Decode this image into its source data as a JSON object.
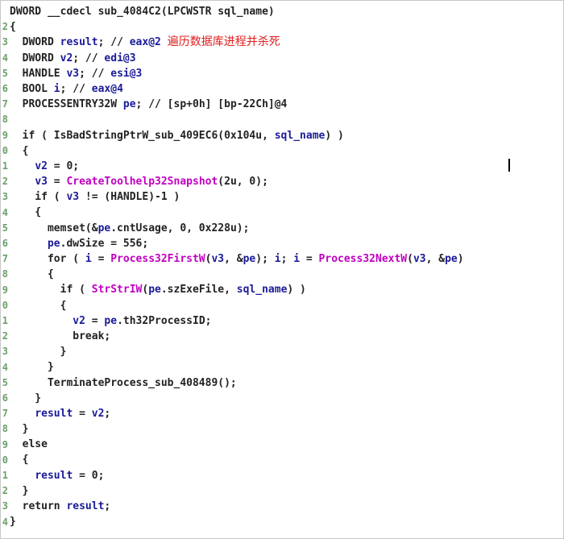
{
  "gutter": [
    "",
    "2",
    "3",
    "4",
    "5",
    "6",
    "7",
    "8",
    "9",
    "0",
    "1",
    "2",
    "3",
    "4",
    "5",
    "6",
    "7",
    "8",
    "9",
    "0",
    "1",
    "2",
    "3",
    "4",
    "5",
    "6",
    "7",
    "8",
    "9",
    "0",
    "1",
    "2",
    "3",
    "4"
  ],
  "lines": [
    [
      [
        "txt",
        "DWORD __cdecl sub_4084C2(LPCWSTR sql_name)"
      ]
    ],
    [
      [
        "txt",
        "{"
      ]
    ],
    [
      [
        "txt",
        "  DWORD "
      ],
      [
        "kw",
        "result"
      ],
      [
        "txt",
        "; // "
      ],
      [
        "kw",
        "eax@2"
      ],
      [
        "txt",
        " "
      ],
      [
        "cjk",
        "遍历数据库进程并杀死"
      ]
    ],
    [
      [
        "txt",
        "  DWORD "
      ],
      [
        "kw",
        "v2"
      ],
      [
        "txt",
        "; // "
      ],
      [
        "kw",
        "edi@3"
      ]
    ],
    [
      [
        "txt",
        "  HANDLE "
      ],
      [
        "kw",
        "v3"
      ],
      [
        "txt",
        "; // "
      ],
      [
        "kw",
        "esi@3"
      ]
    ],
    [
      [
        "txt",
        "  BOOL "
      ],
      [
        "kw",
        "i"
      ],
      [
        "txt",
        "; // "
      ],
      [
        "kw",
        "eax@4"
      ]
    ],
    [
      [
        "txt",
        "  PROCESSENTRY32W "
      ],
      [
        "kw",
        "pe"
      ],
      [
        "txt",
        "; // [sp+0h] [bp-22Ch]@4"
      ]
    ],
    [
      [
        "txt",
        ""
      ]
    ],
    [
      [
        "txt",
        "  if ( IsBadStringPtrW_sub_409EC6(0x104u, "
      ],
      [
        "kw",
        "sql_name"
      ],
      [
        "txt",
        ") )"
      ]
    ],
    [
      [
        "txt",
        "  {"
      ]
    ],
    [
      [
        "txt",
        "    "
      ],
      [
        "kw",
        "v2"
      ],
      [
        "txt",
        " = 0;"
      ]
    ],
    [
      [
        "txt",
        "    "
      ],
      [
        "kw",
        "v3"
      ],
      [
        "txt",
        " = "
      ],
      [
        "fn",
        "CreateToolhelp32Snapshot"
      ],
      [
        "txt",
        "(2u, 0);"
      ]
    ],
    [
      [
        "txt",
        "    if ( "
      ],
      [
        "kw",
        "v3"
      ],
      [
        "txt",
        " != (HANDLE)-1 )"
      ]
    ],
    [
      [
        "txt",
        "    {"
      ]
    ],
    [
      [
        "txt",
        "      memset(&"
      ],
      [
        "kw",
        "pe"
      ],
      [
        "txt",
        ".cntUsage, 0, 0x228u);"
      ]
    ],
    [
      [
        "txt",
        "      "
      ],
      [
        "kw",
        "pe"
      ],
      [
        "txt",
        ".dwSize = 556;"
      ]
    ],
    [
      [
        "txt",
        "      for ( "
      ],
      [
        "kw",
        "i"
      ],
      [
        "txt",
        " = "
      ],
      [
        "fn",
        "Process32FirstW"
      ],
      [
        "txt",
        "("
      ],
      [
        "kw",
        "v3"
      ],
      [
        "txt",
        ", &"
      ],
      [
        "kw",
        "pe"
      ],
      [
        "txt",
        "); "
      ],
      [
        "kw",
        "i"
      ],
      [
        "txt",
        "; "
      ],
      [
        "kw",
        "i"
      ],
      [
        "txt",
        " = "
      ],
      [
        "fn",
        "Process32NextW"
      ],
      [
        "txt",
        "("
      ],
      [
        "kw",
        "v3"
      ],
      [
        "txt",
        ", &"
      ],
      [
        "kw",
        "pe"
      ],
      [
        "txt",
        ")"
      ]
    ],
    [
      [
        "txt",
        "      {"
      ]
    ],
    [
      [
        "txt",
        "        if ( "
      ],
      [
        "fn",
        "StrStrIW"
      ],
      [
        "txt",
        "("
      ],
      [
        "kw",
        "pe"
      ],
      [
        "txt",
        ".szExeFile, "
      ],
      [
        "kw",
        "sql_name"
      ],
      [
        "txt",
        ") )"
      ]
    ],
    [
      [
        "txt",
        "        {"
      ]
    ],
    [
      [
        "txt",
        "          "
      ],
      [
        "kw",
        "v2"
      ],
      [
        "txt",
        " = "
      ],
      [
        "kw",
        "pe"
      ],
      [
        "txt",
        ".th32ProcessID;"
      ]
    ],
    [
      [
        "txt",
        "          break;"
      ]
    ],
    [
      [
        "txt",
        "        }"
      ]
    ],
    [
      [
        "txt",
        "      }"
      ]
    ],
    [
      [
        "txt",
        "      TerminateProcess_sub_408489();"
      ]
    ],
    [
      [
        "txt",
        "    }"
      ]
    ],
    [
      [
        "txt",
        "    "
      ],
      [
        "kw",
        "result"
      ],
      [
        "txt",
        " = "
      ],
      [
        "kw",
        "v2"
      ],
      [
        "txt",
        ";"
      ]
    ],
    [
      [
        "txt",
        "  }"
      ]
    ],
    [
      [
        "txt",
        "  else"
      ]
    ],
    [
      [
        "txt",
        "  {"
      ]
    ],
    [
      [
        "txt",
        "    "
      ],
      [
        "kw",
        "result"
      ],
      [
        "txt",
        " = 0;"
      ]
    ],
    [
      [
        "txt",
        "  }"
      ]
    ],
    [
      [
        "txt",
        "  return "
      ],
      [
        "kw",
        "result"
      ],
      [
        "txt",
        ";"
      ]
    ],
    [
      [
        "txt",
        "}"
      ]
    ]
  ],
  "colors": {
    "identifier": "#1a1a99",
    "function": "#c000c0",
    "annotation": "#e01e1e",
    "text": "#222222",
    "gutter": "#6aa06a"
  }
}
